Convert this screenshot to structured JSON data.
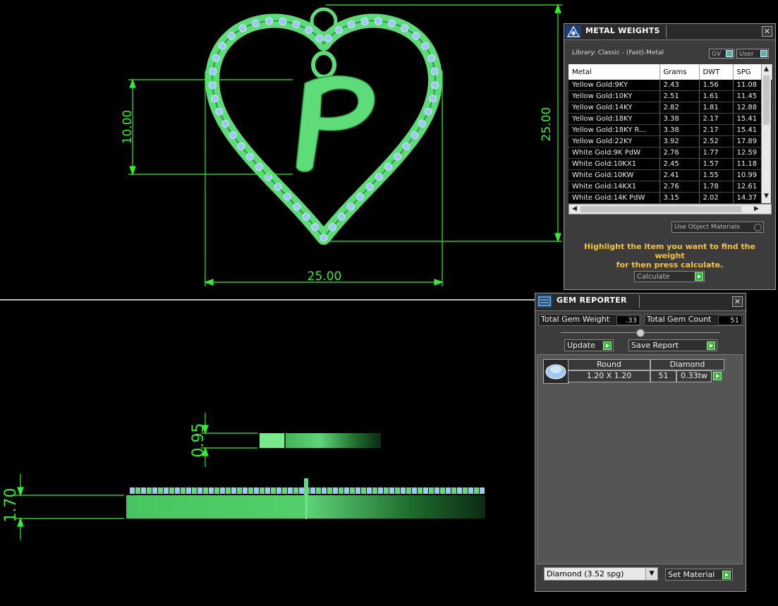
{
  "viewport": {
    "dimensions": {
      "heart_width": "25.00",
      "heart_height": "25.00",
      "letter_height": "10.00",
      "letter_thickness": "0.95",
      "pendant_thickness": "1.70"
    },
    "letter": "P",
    "colors": {
      "metal": "#5fdc7a",
      "gems": "#9ec8f2",
      "dimension": "#33ee33"
    }
  },
  "metal_weights": {
    "title": "METAL WEIGHTS",
    "library_label": "Library: Classic - (Fast)-Metal",
    "gv_label": "GV",
    "user_label": "User",
    "columns": [
      "Metal",
      "Grams",
      "DWT",
      "SPG"
    ],
    "rows": [
      [
        "Yellow Gold:9KY",
        "2.43",
        "1.56",
        "11.08"
      ],
      [
        "Yellow Gold:10KY",
        "2.51",
        "1.61",
        "11.45"
      ],
      [
        "Yellow Gold:14KY",
        "2.82",
        "1.81",
        "12.88"
      ],
      [
        "Yellow Gold:18KY",
        "3.38",
        "2.17",
        "15.41"
      ],
      [
        "Yellow Gold:18KY R...",
        "3.38",
        "2.17",
        "15.41"
      ],
      [
        "Yellow Gold:22KY",
        "3.92",
        "2.52",
        "17.89"
      ],
      [
        "White Gold:9K PdW",
        "2.76",
        "1.77",
        "12.59"
      ],
      [
        "White Gold:10KX1",
        "2.45",
        "1.57",
        "11.18"
      ],
      [
        "White Gold:10KW",
        "2.41",
        "1.55",
        "10.99"
      ],
      [
        "White Gold:14KX1",
        "2.76",
        "1.78",
        "12.61"
      ],
      [
        "White Gold:14K PdW",
        "3.15",
        "2.02",
        "14.37"
      ]
    ],
    "use_object_materials": "Use Object Materials",
    "info_line1": "Highlight the item you want to find the weight",
    "info_line2": "for then press calculate.",
    "calculate_label": "Calculate"
  },
  "gem_reporter": {
    "title": "GEM REPORTER",
    "total_weight_label": "Total Gem Weight",
    "total_weight_value": ".33",
    "total_count_label": "Total Gem Count",
    "total_count_value": "51",
    "update_label": "Update",
    "save_report_label": "Save Report",
    "gem": {
      "shape": "Round",
      "material": "Diamond",
      "size": "1.20 X 1.20",
      "count": "51",
      "weight": "0.33tw"
    },
    "material_select": "Diamond     (3.52 spg)",
    "set_material_label": "Set Material"
  }
}
